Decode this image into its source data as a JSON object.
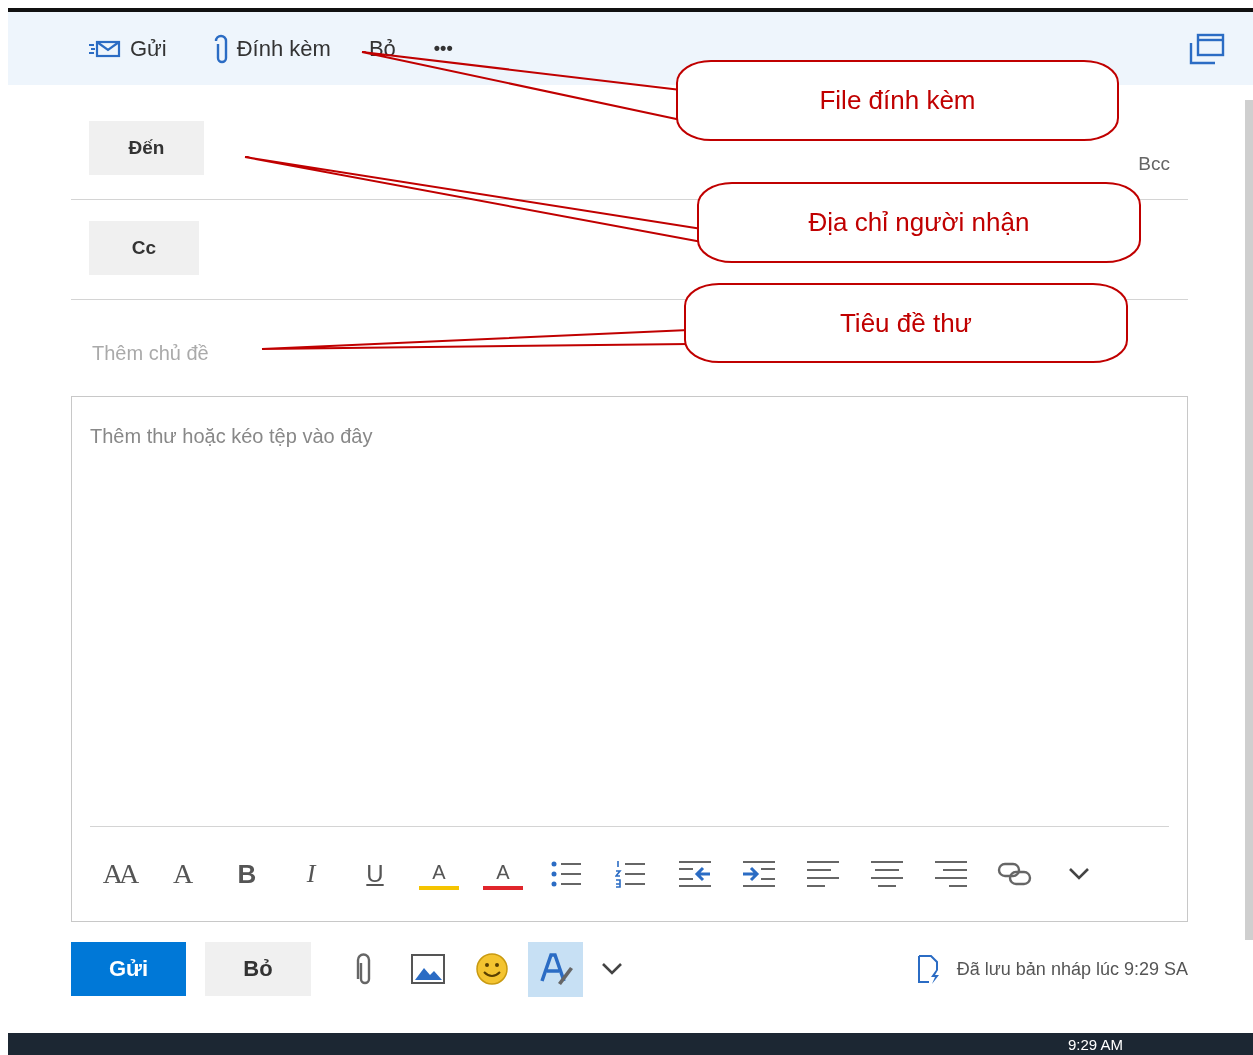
{
  "toolbar": {
    "actions": [
      {
        "kind": "send",
        "label": "Gửi"
      },
      {
        "kind": "attach",
        "label": "Đính kèm"
      },
      {
        "kind": "discard",
        "label": "Bỏ"
      },
      {
        "kind": "more",
        "label": "•••"
      }
    ]
  },
  "recipients": [
    {
      "label": "Đến"
    },
    {
      "label": "Cc"
    }
  ],
  "bcc": "Bcc",
  "subject": {
    "placeholder": "Thêm chủ đề"
  },
  "body": {
    "placeholder": "Thêm thư hoặc kéo tệp vào đây"
  },
  "format_tools": [
    {
      "kind": "font-size",
      "glyph": "AA"
    },
    {
      "kind": "grow",
      "glyph": "A"
    },
    {
      "kind": "bold",
      "glyph": "B"
    },
    {
      "kind": "italic",
      "glyph": "I"
    },
    {
      "kind": "underline",
      "glyph": "U"
    },
    {
      "kind": "highlight",
      "glyph": "A"
    },
    {
      "kind": "color",
      "glyph": "A"
    },
    {
      "kind": "bullets"
    },
    {
      "kind": "numbering"
    },
    {
      "kind": "outdent"
    },
    {
      "kind": "indent"
    },
    {
      "kind": "align-left"
    },
    {
      "kind": "align-center"
    },
    {
      "kind": "align-right"
    },
    {
      "kind": "link"
    },
    {
      "kind": "more"
    }
  ],
  "footer": {
    "send": "Gửi",
    "discard": "Bỏ",
    "tools": [
      {
        "kind": "attach",
        "selected": false
      },
      {
        "kind": "image",
        "selected": false
      },
      {
        "kind": "emoji",
        "selected": false
      },
      {
        "kind": "editor",
        "selected": true
      },
      {
        "kind": "more",
        "selected": false
      }
    ],
    "draft_status": "Đã lưu bản nháp lúc 9:29 SA"
  },
  "callouts": [
    {
      "text": "File đính kèm"
    },
    {
      "text": "Địa chỉ người nhận"
    },
    {
      "text": "Tiêu đề thư"
    }
  ],
  "taskbar": {
    "clock": "9:29 AM"
  }
}
